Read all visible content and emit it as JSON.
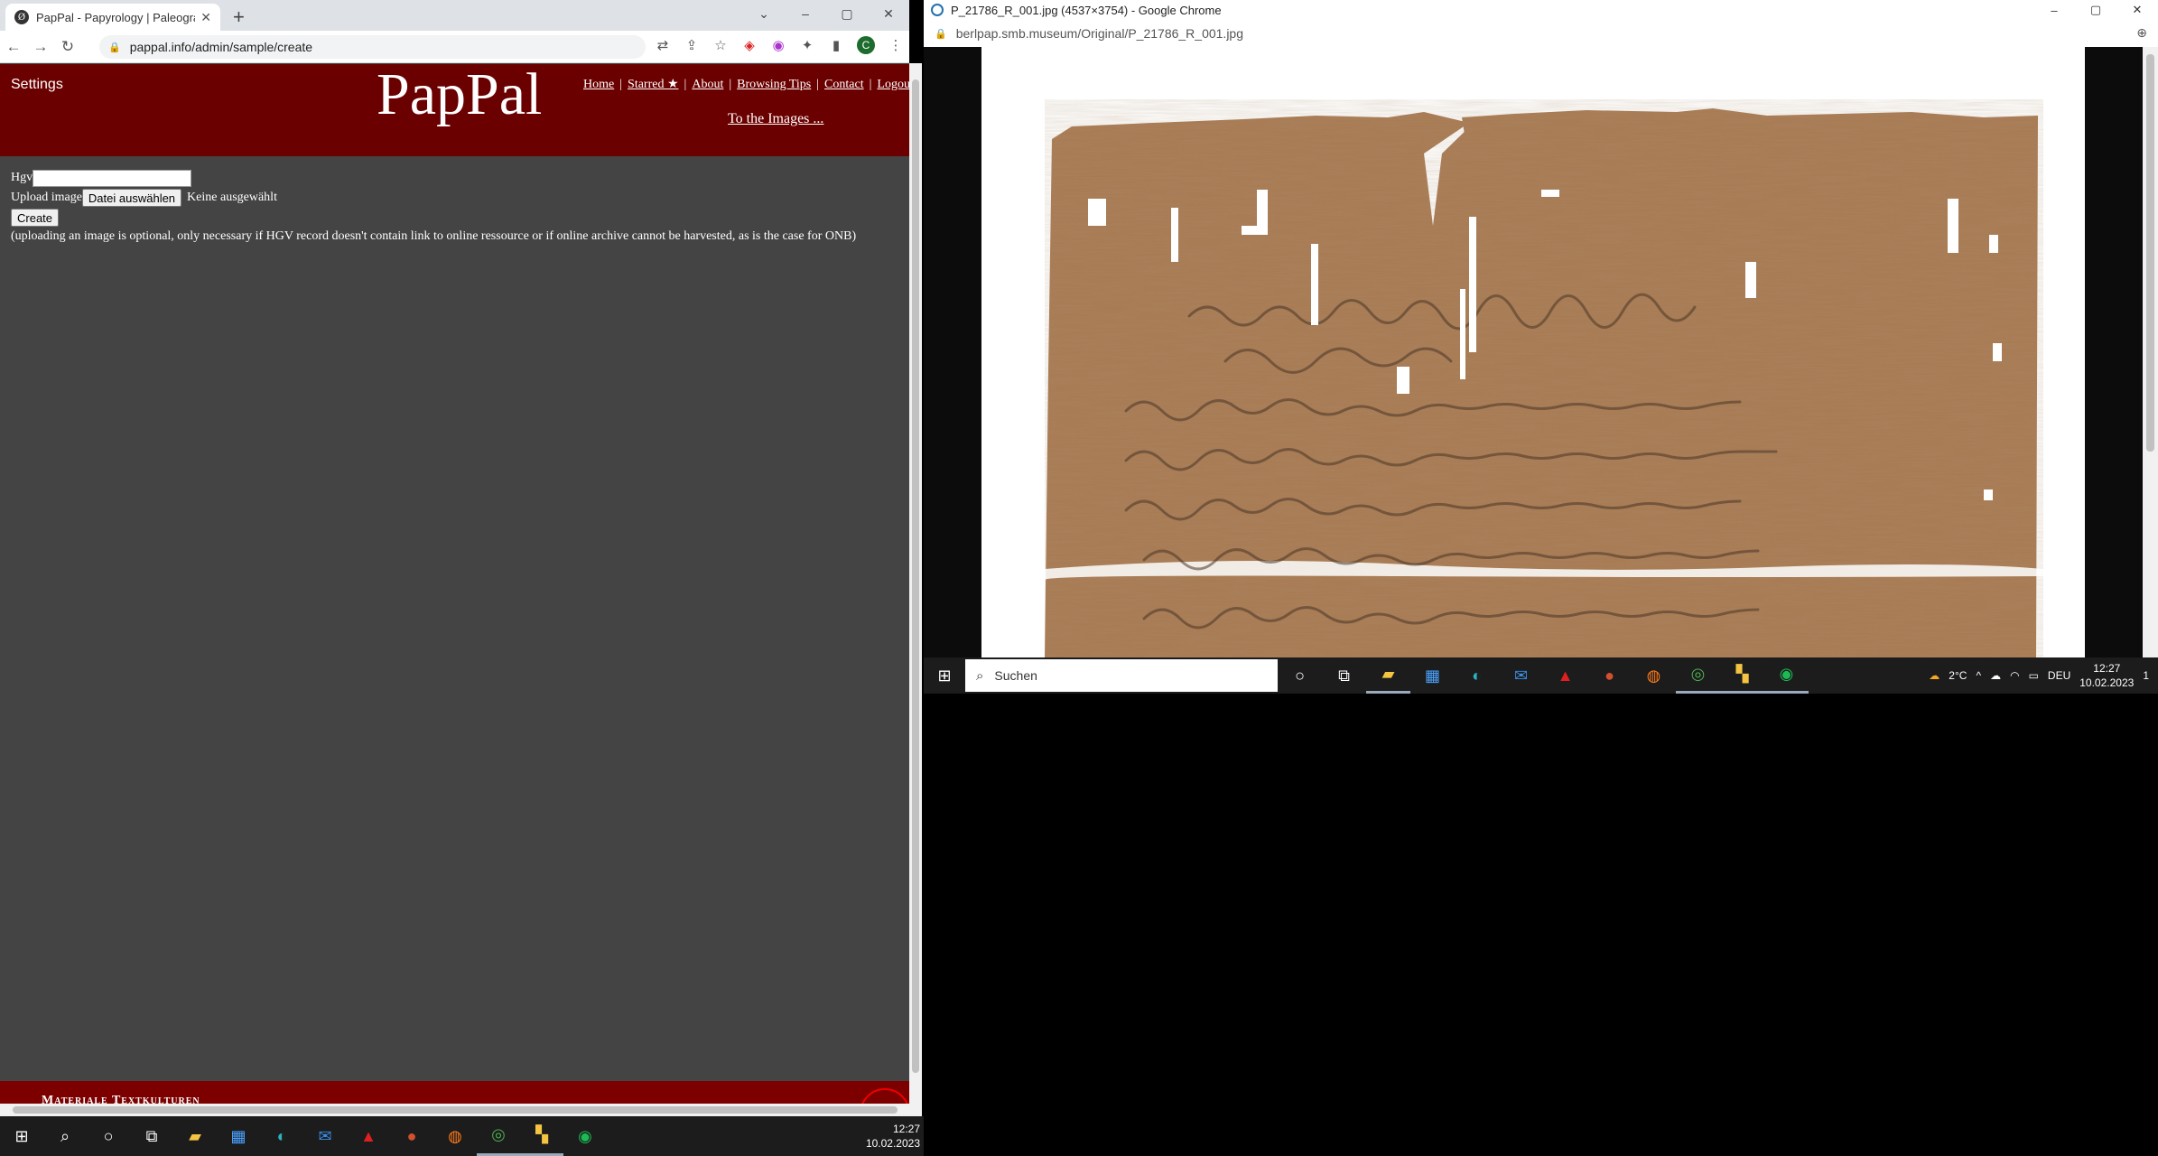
{
  "left_browser": {
    "tab_title": "PapPal - Papyrology | Paleograph",
    "favicon_letter": "Ø",
    "url": "pappal.info/admin/sample/create",
    "profile_letter": "C",
    "window_controls": {
      "minimize": "–",
      "restore": "▢",
      "close": "✕"
    }
  },
  "site": {
    "settings_label": "Settings",
    "logo": "PapPal",
    "nav": {
      "home": "Home",
      "starred": "Starred ★",
      "about": "About",
      "browsing_tips": "Browsing Tips",
      "contact": "Contact",
      "logout": "Logou"
    },
    "to_images": "To the Images ...",
    "form": {
      "hgv_label": "Hgv",
      "hgv_value": "",
      "upload_label": "Upload image",
      "file_button": "Datei auswählen",
      "file_status": "Keine ausgewählt",
      "create_button": "Create",
      "note": "(uploading an image is optional, only necessary if HGV record doesn't contain link to online ressource or if online archive cannot be harvested, as is the case for ONB)"
    },
    "footer_text": "Materiale Textkulturen"
  },
  "taskbar_left": {
    "time": "12:27",
    "date": "10.02.2023"
  },
  "right_browser": {
    "title": "P_21786_R_001.jpg (4537×3754) - Google Chrome",
    "url": "berlpap.smb.museum/Original/P_21786_R_001.jpg",
    "window_controls": {
      "minimize": "–",
      "restore": "▢",
      "close": "✕"
    }
  },
  "taskbar_right": {
    "search_placeholder": "Suchen",
    "weather": "2°C",
    "language": "DEU",
    "time": "12:27",
    "date": "10.02.2023",
    "notification_count": "1"
  },
  "colors": {
    "header_red": "#6b0000",
    "page_bg": "#444444",
    "papyrus": "#a87a52"
  }
}
